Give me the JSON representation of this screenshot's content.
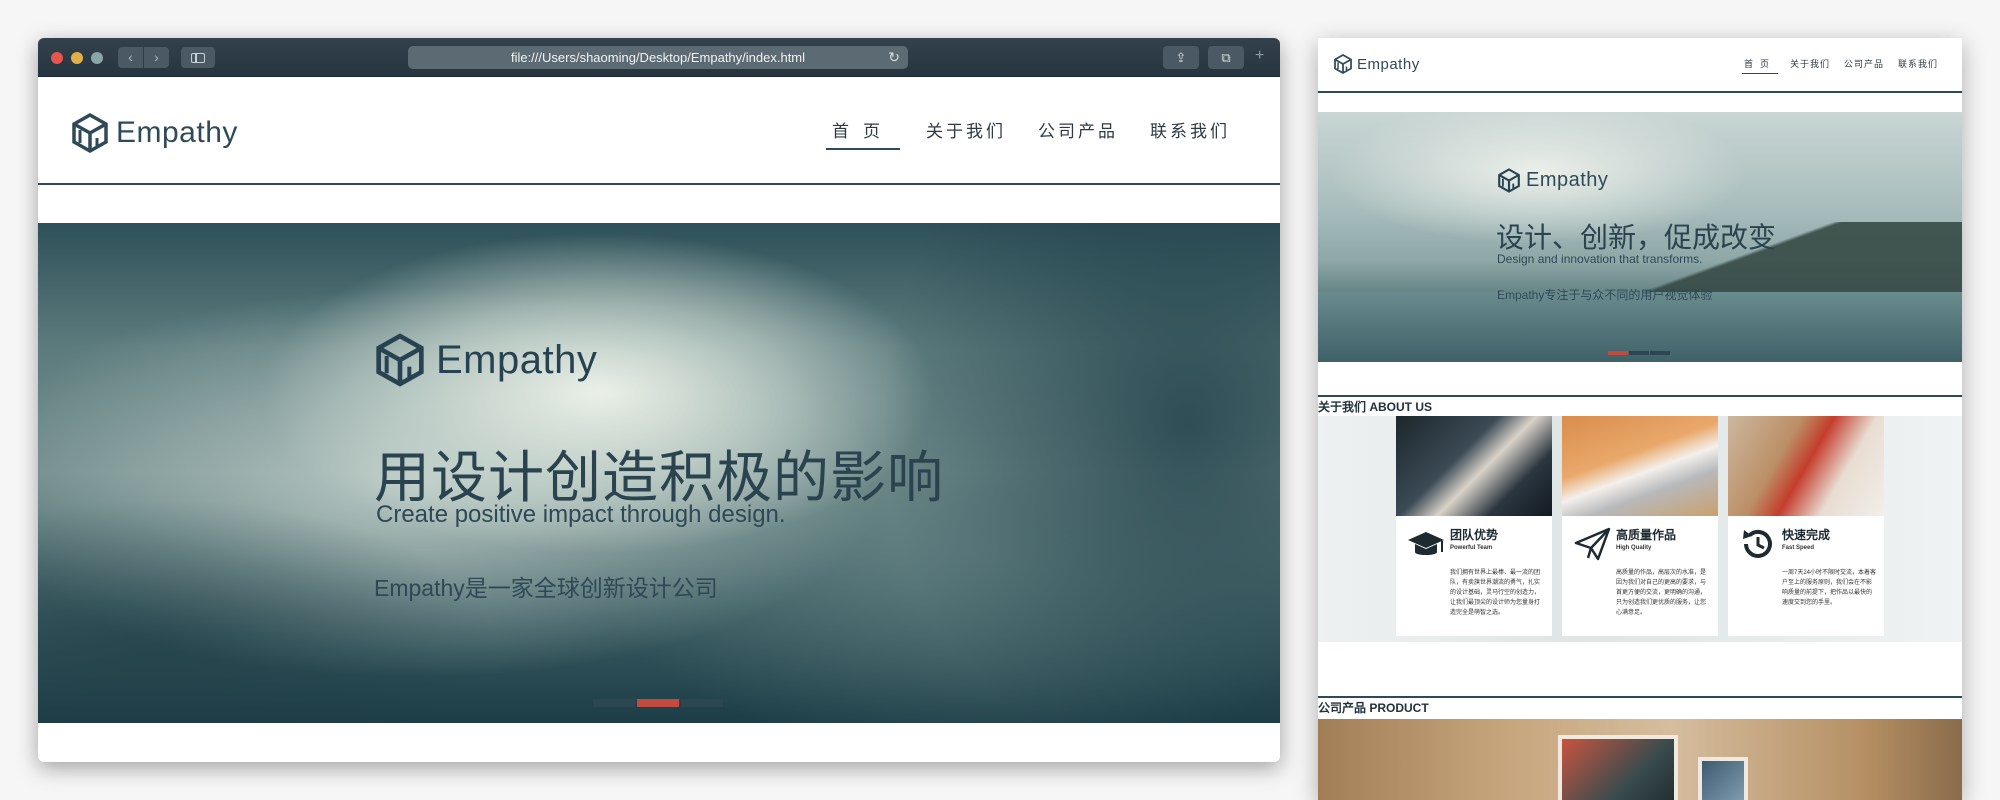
{
  "browser": {
    "url": "file:///Users/shaoming/Desktop/Empathy/index.html",
    "nav_back": "‹",
    "nav_forward": "›",
    "reload_icon": "↻",
    "share_icon": "⇪",
    "tabs_icon": "⧉",
    "new_tab_icon": "+"
  },
  "site": {
    "brand": "Empathy",
    "nav": [
      {
        "label": "首页",
        "active": true
      },
      {
        "label": "关于我们",
        "active": false
      },
      {
        "label": "公司产品",
        "active": false
      },
      {
        "label": "联系我们",
        "active": false
      }
    ],
    "hero": {
      "brand": "Empathy",
      "title": "用设计创造积极的影响",
      "subtitle": "Create positive impact through design.",
      "description": "Empathy是一家全球创新设计公司",
      "slides": 3,
      "active_slide": 2
    }
  },
  "preview": {
    "brand": "Empathy",
    "nav": [
      {
        "label": "首页",
        "active": true
      },
      {
        "label": "关于我们",
        "active": false
      },
      {
        "label": "公司产品",
        "active": false
      },
      {
        "label": "联系我们",
        "active": false
      }
    ],
    "hero": {
      "brand": "Empathy",
      "title": "设计、创新，促成改变",
      "subtitle": "Design and innovation that transforms.",
      "description": "Empathy专注于与众不同的用户视觉体验",
      "slides": 3,
      "active_slide": 1
    },
    "about_title": "关于我们 ABOUT US",
    "cards": [
      {
        "icon": "graduation-cap-icon",
        "title": "团队优势",
        "subtitle": "Powerful Team",
        "text": "我们拥有世界上最棒、最一流的团队，有卖旗世界潮流的勇气，扎实的设计基础，灵马行空的创造力，让我们最顶尖的设计师为您量身打造完全是萌智之选。"
      },
      {
        "icon": "paper-plane-icon",
        "title": "高质量作品",
        "subtitle": "High Quality",
        "text": "高质量的作品，高层次的水准，是因为我们对自己的更高的要求，与首更方便的交流，更明确的沟通，只为创造我们更优质的服务，让您心满意足。"
      },
      {
        "icon": "clock-icon",
        "title": "快速完成",
        "subtitle": "Fast Speed",
        "text": "一周7天24小时不限时交流，本着客户至上的服务原则，我们会在不影响质量的前提下，把作品以最快的速度交到您的手里。"
      }
    ],
    "product_title": "公司产品 PRODUCT"
  }
}
